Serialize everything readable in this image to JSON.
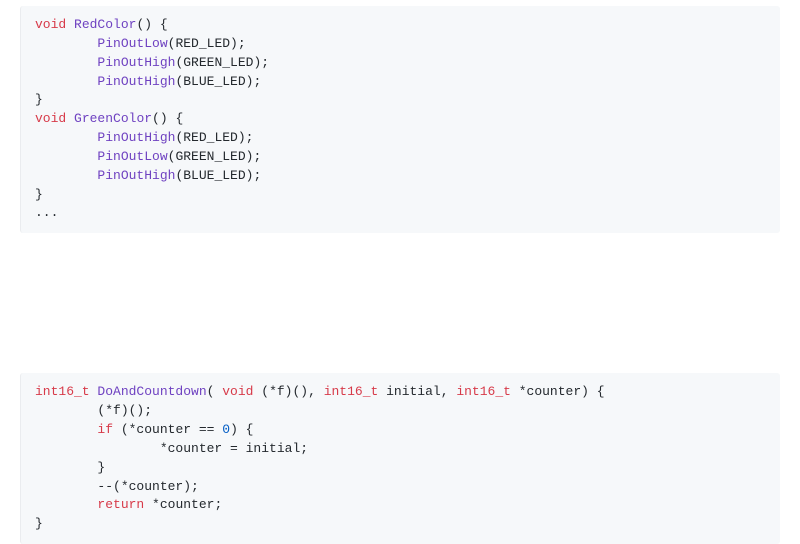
{
  "block1": {
    "t1": "void",
    "fn1": "RedColor",
    "p1a": "() {",
    "call1": "PinOutLow",
    "arg1": "(RED_LED);",
    "call2": "PinOutHigh",
    "arg2": "(GREEN_LED);",
    "call3": "PinOutHigh",
    "arg3": "(BLUE_LED);",
    "close1": "}",
    "t2": "void",
    "fn2": "GreenColor",
    "p2a": "() {",
    "call4": "PinOutHigh",
    "arg4": "(RED_LED);",
    "call5": "PinOutLow",
    "arg5": "(GREEN_LED);",
    "call6": "PinOutHigh",
    "arg6": "(BLUE_LED);",
    "close2": "}",
    "ellipsis": "..."
  },
  "block2": {
    "rettype": "int16_t",
    "fn": "DoAndCountdown",
    "sig1": "( ",
    "kw_void": "void",
    "sig2": " (*f)(), ",
    "pt1": "int16_t",
    "sig3": " initial, ",
    "pt2": "int16_t",
    "sig4": " *counter) {",
    "l2": "        (*f)();",
    "l3a": "        ",
    "kw_if": "if",
    "l3b": " (*counter == ",
    "zero": "0",
    "l3c": ") {",
    "l4": "                *counter = initial;",
    "l5": "        }",
    "l6": "        --(*counter);",
    "l7a": "        ",
    "kw_return": "return",
    "l7b": " *counter;",
    "close": "}"
  }
}
